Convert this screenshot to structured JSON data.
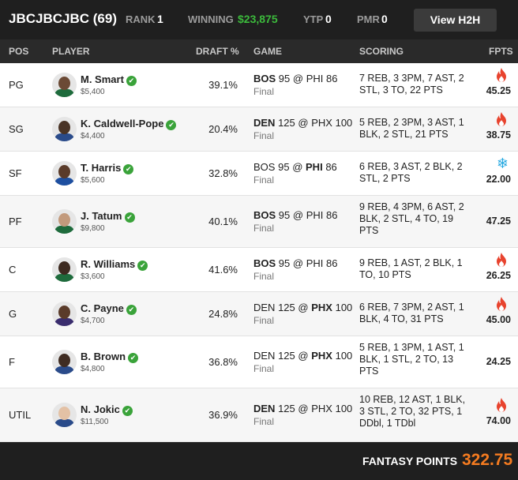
{
  "header": {
    "team_name": "JBCJBCJBC (69)",
    "rank_label": "RANK",
    "rank_value": "1",
    "winning_label": "WINNING",
    "winning_value": "$23,875",
    "ytp_label": "YTP",
    "ytp_value": "0",
    "pmr_label": "PMR",
    "pmr_value": "0",
    "h2h_button": "View H2H"
  },
  "columns": {
    "pos": "POS",
    "player": "PLAYER",
    "draft": "DRAFT %",
    "game": "GAME",
    "scoring": "SCORING",
    "fpts": "FPTS"
  },
  "colors": {
    "accent": "#f47b20",
    "winning": "#3cbb3c",
    "check": "#3aa33a",
    "fire": "#e8432e",
    "ice": "#27a9e1"
  },
  "rows": [
    {
      "pos": "PG",
      "name": "M. Smart",
      "salary": "$5,400",
      "draft": "39.1%",
      "game_away": "BOS",
      "away_score": "95",
      "at": "@",
      "game_home": "PHI",
      "home_score": "86",
      "bold_team": "away",
      "status": "Final",
      "scoring": "7 REB, 3 3PM, 7 AST, 2 STL, 3 TO, 22 PTS",
      "fpts": "45.25",
      "indicator": "fire-icon"
    },
    {
      "pos": "SG",
      "name": "K. Caldwell-Pope",
      "salary": "$4,400",
      "draft": "20.4%",
      "game_away": "DEN",
      "away_score": "125",
      "at": "@",
      "game_home": "PHX",
      "home_score": "100",
      "bold_team": "away",
      "status": "Final",
      "scoring": "5 REB, 2 3PM, 3 AST, 1 BLK, 2 STL, 21 PTS",
      "fpts": "38.75",
      "indicator": "fire-icon"
    },
    {
      "pos": "SF",
      "name": "T. Harris",
      "salary": "$5,600",
      "draft": "32.8%",
      "game_away": "BOS",
      "away_score": "95",
      "at": "@",
      "game_home": "PHI",
      "home_score": "86",
      "bold_team": "home",
      "status": "Final",
      "scoring": "6 REB, 3 AST, 2 BLK, 2 STL, 2 PTS",
      "fpts": "22.00",
      "indicator": "snowflake-icon"
    },
    {
      "pos": "PF",
      "name": "J. Tatum",
      "salary": "$9,800",
      "draft": "40.1%",
      "game_away": "BOS",
      "away_score": "95",
      "at": "@",
      "game_home": "PHI",
      "home_score": "86",
      "bold_team": "away",
      "status": "Final",
      "scoring": "9 REB, 4 3PM, 6 AST, 2 BLK, 2 STL, 4 TO, 19 PTS",
      "fpts": "47.25",
      "indicator": ""
    },
    {
      "pos": "C",
      "name": "R. Williams",
      "salary": "$3,600",
      "draft": "41.6%",
      "game_away": "BOS",
      "away_score": "95",
      "at": "@",
      "game_home": "PHI",
      "home_score": "86",
      "bold_team": "away",
      "status": "Final",
      "scoring": "9 REB, 1 AST, 2 BLK, 1 TO, 10 PTS",
      "fpts": "26.25",
      "indicator": "fire-icon"
    },
    {
      "pos": "G",
      "name": "C. Payne",
      "salary": "$4,700",
      "draft": "24.8%",
      "game_away": "DEN",
      "away_score": "125",
      "at": "@",
      "game_home": "PHX",
      "home_score": "100",
      "bold_team": "home",
      "status": "Final",
      "scoring": "6 REB, 7 3PM, 2 AST, 1 BLK, 4 TO, 31 PTS",
      "fpts": "45.00",
      "indicator": "fire-icon"
    },
    {
      "pos": "F",
      "name": "B. Brown",
      "salary": "$4,800",
      "draft": "36.8%",
      "game_away": "DEN",
      "away_score": "125",
      "at": "@",
      "game_home": "PHX",
      "home_score": "100",
      "bold_team": "home",
      "status": "Final",
      "scoring": "5 REB, 1 3PM, 1 AST, 1 BLK, 1 STL, 2 TO, 13 PTS",
      "fpts": "24.25",
      "indicator": ""
    },
    {
      "pos": "UTIL",
      "name": "N. Jokic",
      "salary": "$11,500",
      "draft": "36.9%",
      "game_away": "DEN",
      "away_score": "125",
      "at": "@",
      "game_home": "PHX",
      "home_score": "100",
      "bold_team": "away",
      "status": "Final",
      "scoring": "10 REB, 12 AST, 1 BLK, 3 STL, 2 TO, 32 PTS, 1 DDbl, 1 TDbl",
      "fpts": "74.00",
      "indicator": "fire-icon"
    }
  ],
  "footer": {
    "label": "FANTASY POINTS",
    "total": "322.75"
  }
}
